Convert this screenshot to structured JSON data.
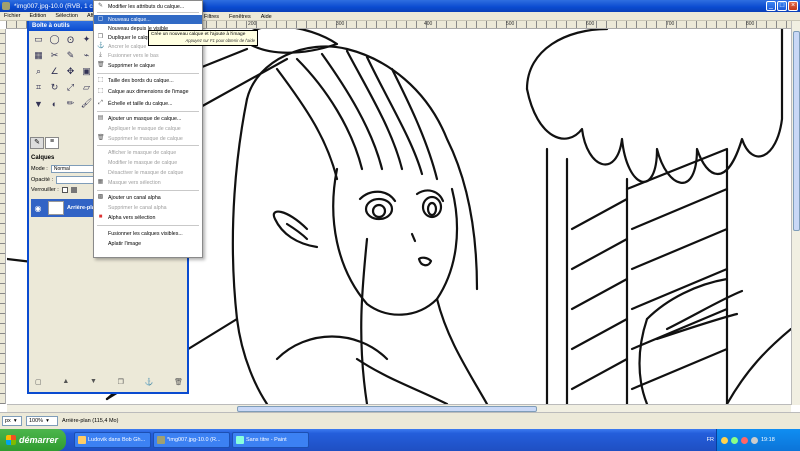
{
  "window": {
    "title": "*img007.jpg-10.0 (RVB, 1 calque) 800x600 – GIMP"
  },
  "menubar": {
    "items": [
      "Fichier",
      "Edition",
      "Sélection",
      "Affichage"
    ],
    "items_right": [
      "Filtres",
      "Fenêtres",
      "Aide"
    ]
  },
  "rulers": {
    "top_labels": [
      "200",
      "300",
      "400",
      "500",
      "600",
      "700",
      "800"
    ]
  },
  "toolbox": {
    "title": "Boîte à outils",
    "layers_header": "Calques",
    "mode_label": "Mode :",
    "mode_value": "Normal",
    "opacity_label": "Opacité :",
    "lock_label": "Verrouiller :",
    "layer_name": "Arrière-plan"
  },
  "layer_menu": {
    "items": [
      {
        "label": "Modifier les attributs du calque...",
        "disabled": false
      },
      {
        "label": "Nouveau calque...",
        "disabled": false,
        "highlight": true
      },
      {
        "label": "Nouveau depuis le visible",
        "disabled": false
      },
      {
        "label": "Dupliquer le calque",
        "disabled": false
      },
      {
        "label": "Ancrer le calque",
        "disabled": true
      },
      {
        "label": "Fusionner vers le bas",
        "disabled": true
      },
      {
        "label": "Supprimer le calque",
        "disabled": false
      },
      {
        "label": "Taille des bords du calque...",
        "disabled": false
      },
      {
        "label": "Calque aux dimensions de l'image",
        "disabled": false
      },
      {
        "label": "Échelle et taille du calque...",
        "disabled": false
      },
      {
        "label": "Ajouter un masque de calque...",
        "disabled": false
      },
      {
        "label": "Appliquer le masque de calque",
        "disabled": true
      },
      {
        "label": "Supprimer le masque de calque",
        "disabled": true
      },
      {
        "label": "Afficher le masque de calque",
        "disabled": true
      },
      {
        "label": "Modifier le masque de calque",
        "disabled": true
      },
      {
        "label": "Désactiver le masque de calque",
        "disabled": true
      },
      {
        "label": "Masque vers sélection",
        "disabled": true
      },
      {
        "label": "Ajouter un canal alpha",
        "disabled": false
      },
      {
        "label": "Supprimer le canal alpha",
        "disabled": true
      },
      {
        "label": "Alpha vers sélection",
        "disabled": false
      },
      {
        "label": "Fusionner les calques visibles...",
        "disabled": false
      },
      {
        "label": "Aplatir l'image",
        "disabled": false
      }
    ]
  },
  "tooltip": {
    "text": "Crée un nouveau calque et l'ajoute à l'image",
    "hint": "Appuyez sur F1 pour obtenir de l'aide"
  },
  "statusbar": {
    "units": "px",
    "zoom": "100%",
    "message": "Arrière-plan (115,4 Mo)"
  },
  "taskbar": {
    "start_label": "démarrer",
    "tasks": [
      {
        "label": "Ludovik dans Bob Gh...",
        "active": false
      },
      {
        "label": "*img007.jpg-10.0 (R...",
        "active": false
      },
      {
        "label": "Sans titre - Paint",
        "active": false
      }
    ],
    "language": "FR",
    "clock": "19:18"
  }
}
